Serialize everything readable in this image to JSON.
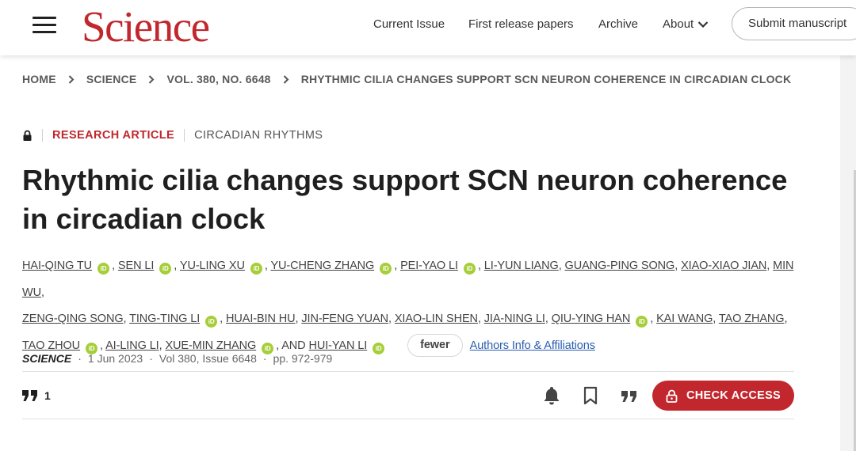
{
  "header": {
    "logo": "Science",
    "nav": {
      "current_issue": "Current Issue",
      "first_release": "First release papers",
      "archive": "Archive",
      "about": "About",
      "submit": "Submit manuscript"
    }
  },
  "breadcrumb": [
    "HOME",
    "SCIENCE",
    "VOL. 380, NO. 6648",
    "RHYTHMIC CILIA CHANGES SUPPORT SCN NEURON COHERENCE IN CIRCADIAN CLOCK"
  ],
  "article": {
    "type": "RESEARCH ARTICLE",
    "topic": "CIRCADIAN RHYTHMS",
    "title": "Rhythmic cilia changes support SCN neuron coherence in circadian clock",
    "authors": [
      "HAI-QING TU",
      "SEN LI",
      "YU-LING XU",
      "YU-CHENG ZHANG",
      "PEI-YAO LI",
      "LI-YUN LIANG",
      "GUANG-PING SONG",
      "XIAO-XIAO JIAN",
      "MIN WU",
      "ZENG-QING SONG",
      "TING-TING LI",
      "HUAI-BIN HU",
      "JIN-FENG YUAN",
      "XIAO-LIN SHEN",
      "JIA-NING LI",
      "QIU-YING HAN",
      "KAI WANG",
      "TAO ZHANG",
      "TAO ZHOU",
      "AI-LING LI",
      "XUE-MIN ZHANG",
      "HUI-YAN LI"
    ],
    "and_label": "AND",
    "orcid_label": "iD",
    "fewer_label": "fewer",
    "affiliations_link": "Authors Info & Affiliations",
    "journal": "SCIENCE",
    "date": "1 Jun 2023",
    "volume_issue": "Vol 380, Issue 6648",
    "pages": "pp. 972-979",
    "citation_count": "1",
    "check_access": "CHECK ACCESS"
  },
  "colors": {
    "brand_red": "#c1272d",
    "orcid_green": "#a6ce39",
    "link_blue": "#2a5db0"
  },
  "icons": [
    "menu-icon",
    "chevron-down-icon",
    "chevron-right-icon",
    "lock-icon",
    "orcid-icon",
    "quote-icon",
    "bell-icon",
    "bookmark-icon"
  ]
}
